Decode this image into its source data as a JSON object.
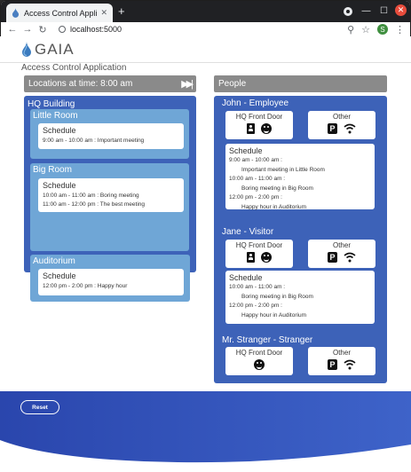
{
  "browser": {
    "tab_title": "Access Control Applicatio",
    "url": "localhost:5000",
    "profile_initial": "S"
  },
  "app": {
    "brand": "GAIA",
    "title": "Access Control Application"
  },
  "locations": {
    "header": "Locations at time: 8:00 am",
    "building": "HQ Building",
    "rooms": [
      {
        "name": "Little Room",
        "schedule_label": "Schedule",
        "events": [
          "9:00 am - 10:00 am : Important meeting"
        ]
      },
      {
        "name": "Big Room",
        "schedule_label": "Schedule",
        "events": [
          "10:00 am - 11:00 am : Boring meeting",
          "11:00 am - 12:00 pm : The best meeting"
        ]
      },
      {
        "name": "Auditorium",
        "schedule_label": "Schedule",
        "events": [
          "12:00 pm - 2:00 pm : Happy hour"
        ]
      }
    ]
  },
  "people": {
    "header": "People",
    "list": [
      {
        "name": "John - Employee",
        "access": [
          {
            "label": "HQ Front Door",
            "icons": [
              "badge-icon",
              "face-icon"
            ]
          },
          {
            "label": "Other",
            "icons": [
              "parking-icon",
              "wifi-icon"
            ]
          }
        ],
        "schedule_label": "Schedule",
        "lines": [
          "9:00 am - 10:00 am :",
          "Important meeting in Little Room",
          "10:00 am - 11:00 am :",
          "Boring meeting in Big Room",
          "12:00 pm - 2:00 pm :",
          "Happy hour in Auditorium"
        ]
      },
      {
        "name": "Jane - Visitor",
        "access": [
          {
            "label": "HQ Front Door",
            "icons": [
              "badge-icon",
              "face-icon"
            ]
          },
          {
            "label": "Other",
            "icons": [
              "parking-icon",
              "wifi-icon"
            ]
          }
        ],
        "schedule_label": "Schedule",
        "lines": [
          "10:00 am - 11:00 am :",
          "Boring meeting in Big Room",
          "12:00 pm - 2:00 pm :",
          "Happy hour in Auditorium"
        ]
      },
      {
        "name": "Mr. Stranger - Stranger",
        "access": [
          {
            "label": "HQ Front Door",
            "icons": [
              "face-icon"
            ]
          },
          {
            "label": "Other",
            "icons": [
              "parking-icon",
              "wifi-icon"
            ]
          }
        ]
      }
    ]
  },
  "footer": {
    "reset_label": "Reset"
  },
  "colors": {
    "panel_blue": "#3d62b8",
    "room_blue": "#6fa6d6",
    "header_gray": "#8a8a8a",
    "footer_blue": "#2c4fb8"
  }
}
